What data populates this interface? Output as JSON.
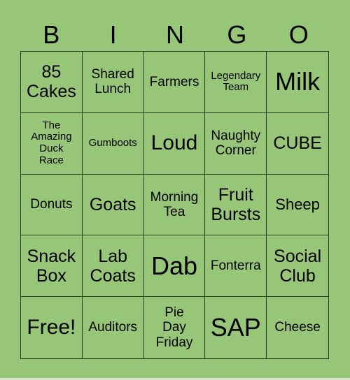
{
  "header": {
    "letters": [
      "B",
      "I",
      "N",
      "G",
      "O"
    ]
  },
  "colors": {
    "background": "#98c679",
    "grid_line": "#2d3a22",
    "text": "#000000"
  },
  "cells": [
    {
      "text": "85 Cakes",
      "lines": [
        "85",
        "Cakes"
      ]
    },
    {
      "text": "Shared Lunch",
      "lines": [
        "Shared",
        "Lunch"
      ]
    },
    {
      "text": "Farmers",
      "lines": [
        "Farmers"
      ]
    },
    {
      "text": "Legendary Team",
      "lines": [
        "Legendary",
        "Team"
      ]
    },
    {
      "text": "Milk",
      "lines": [
        "Milk"
      ]
    },
    {
      "text": "The Amazing Duck Race",
      "lines": [
        "The",
        "Amazing",
        "Duck",
        "Race"
      ]
    },
    {
      "text": "Gumboots",
      "lines": [
        "Gumboots"
      ]
    },
    {
      "text": "Loud",
      "lines": [
        "Loud"
      ]
    },
    {
      "text": "Naughty Corner",
      "lines": [
        "Naughty",
        "Corner"
      ]
    },
    {
      "text": "CUBE",
      "lines": [
        "CUBE"
      ]
    },
    {
      "text": "Donuts",
      "lines": [
        "Donuts"
      ]
    },
    {
      "text": "Goats",
      "lines": [
        "Goats"
      ]
    },
    {
      "text": "Morning Tea",
      "lines": [
        "Morning",
        "Tea"
      ]
    },
    {
      "text": "Fruit Bursts",
      "lines": [
        "Fruit",
        "Bursts"
      ]
    },
    {
      "text": "Sheep",
      "lines": [
        "Sheep"
      ]
    },
    {
      "text": "Snack Box",
      "lines": [
        "Snack",
        "Box"
      ]
    },
    {
      "text": "Lab Coats",
      "lines": [
        "Lab",
        "Coats"
      ]
    },
    {
      "text": "Dab",
      "lines": [
        "Dab"
      ]
    },
    {
      "text": "Fonterra",
      "lines": [
        "Fonterra"
      ]
    },
    {
      "text": "Social Club",
      "lines": [
        "Social",
        "Club"
      ]
    },
    {
      "text": "Free!",
      "lines": [
        "Free!"
      ]
    },
    {
      "text": "Auditors",
      "lines": [
        "Auditors"
      ]
    },
    {
      "text": "Pie Day Friday",
      "lines": [
        "Pie",
        "Day",
        "Friday"
      ]
    },
    {
      "text": "SAP",
      "lines": [
        "SAP"
      ]
    },
    {
      "text": "Cheese",
      "lines": [
        "Cheese"
      ]
    }
  ]
}
